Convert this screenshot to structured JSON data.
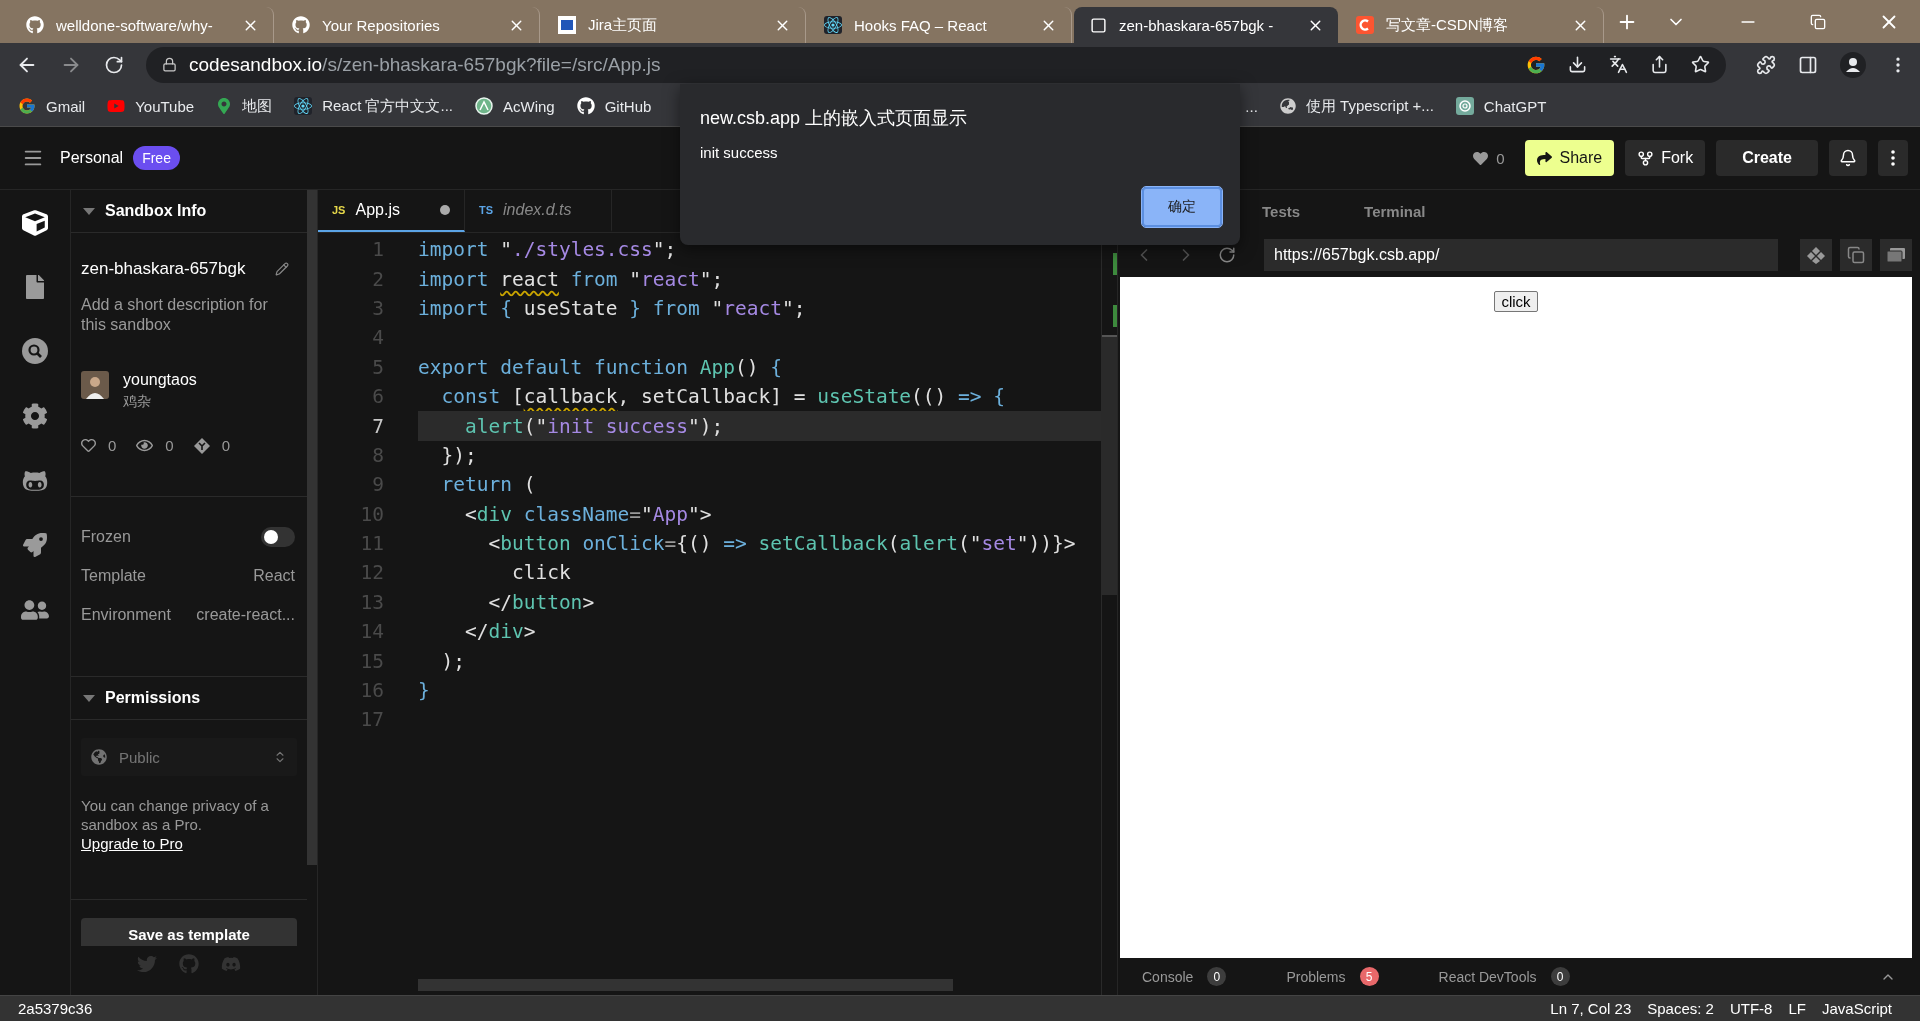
{
  "browser": {
    "tabs": [
      {
        "title": "welldone-software/why-",
        "selected": false
      },
      {
        "title": "Your Repositories",
        "selected": false
      },
      {
        "title": "Jira主页面",
        "selected": false
      },
      {
        "title": "Hooks FAQ – React",
        "selected": false
      },
      {
        "title": "zen-bhaskara-657bgk -",
        "selected": true
      },
      {
        "title": "写文章-CSDN博客",
        "selected": false
      }
    ],
    "address": {
      "host": "codesandbox.io",
      "path": "/s/zen-bhaskara-657bgk?file=/src/App.js"
    },
    "bookmarks": [
      {
        "label": "Gmail"
      },
      {
        "label": "YouTube"
      },
      {
        "label": "地图"
      },
      {
        "label": "React 官方中文文..."
      },
      {
        "label": "AcWing"
      },
      {
        "label": "GitHub"
      }
    ],
    "bookmarks_more": [
      {
        "label": "..."
      },
      {
        "label": "使用 Typescript +..."
      },
      {
        "label": "ChatGPT"
      }
    ]
  },
  "dialog": {
    "title": "new.csb.app 上的嵌入式页面显示",
    "message": "init success",
    "button": "确定"
  },
  "header": {
    "workspace": "Personal",
    "plan": "Free",
    "likes": "0",
    "buttons": [
      {
        "label": "Share",
        "kind": "primary"
      },
      {
        "label": "Fork",
        "kind": "fork"
      },
      {
        "label": "Create",
        "kind": "plain"
      }
    ]
  },
  "rail": [
    {
      "selected": true
    },
    {
      "selected": false
    },
    {
      "selected": false
    },
    {
      "selected": false
    },
    {
      "selected": false
    },
    {
      "selected": false
    },
    {
      "selected": false
    }
  ],
  "sandbox_info": {
    "heading": "Sandbox Info",
    "name": "zen-bhaskara-657bgk",
    "description": "Add a short description for this sandbox",
    "author": {
      "name": "youngtaos",
      "team": "鸡杂"
    },
    "stats": [
      {
        "kind": "likes",
        "value": "0"
      },
      {
        "kind": "views",
        "value": "0"
      },
      {
        "kind": "forks",
        "value": "0"
      }
    ],
    "settings": [
      {
        "kind": "toggle",
        "label": "Frozen",
        "on": false
      },
      {
        "kind": "value",
        "label": "Template",
        "value": "React"
      },
      {
        "kind": "value",
        "label": "Environment",
        "value": "create-react..."
      }
    ]
  },
  "permissions": {
    "heading": "Permissions",
    "privacy": {
      "value": "Public",
      "disabled": true
    },
    "note": "You can change privacy of a sandbox as a Pro.",
    "link": "Upgrade to Pro",
    "save_button": "Save as template"
  },
  "editor": {
    "tabs": [
      {
        "name": "App.js",
        "lang": "JS",
        "selected": true,
        "unsaved": true
      },
      {
        "name": "index.d.ts",
        "lang": "TS",
        "selected": false,
        "unsaved": false
      }
    ],
    "lines": [
      {
        "number": "1",
        "selected": false,
        "tokens": [
          {
            "text": "import ",
            "kind": "kw"
          },
          {
            "text": "\"",
            "kind": "p"
          },
          {
            "text": "./styles.css",
            "kind": "str"
          },
          {
            "text": "\";",
            "kind": "p"
          }
        ]
      },
      {
        "number": "2",
        "selected": false,
        "tokens": [
          {
            "text": "import ",
            "kind": "kw"
          },
          {
            "text": "react",
            "kind": "warn"
          },
          {
            "text": " from ",
            "kind": "kw"
          },
          {
            "text": "\"",
            "kind": "p"
          },
          {
            "text": "react",
            "kind": "str"
          },
          {
            "text": "\";",
            "kind": "p"
          }
        ]
      },
      {
        "number": "3",
        "selected": false,
        "tokens": [
          {
            "text": "import { ",
            "kind": "kw"
          },
          {
            "text": "useState ",
            "kind": "p"
          },
          {
            "text": "} from ",
            "kind": "kw"
          },
          {
            "text": "\"",
            "kind": "p"
          },
          {
            "text": "react",
            "kind": "str"
          },
          {
            "text": "\";",
            "kind": "p"
          }
        ]
      },
      {
        "number": "4",
        "selected": false
      },
      {
        "number": "5",
        "selected": false,
        "tokens": [
          {
            "text": "export default function ",
            "kind": "kw"
          },
          {
            "text": "App",
            "kind": "fn"
          },
          {
            "text": "() ",
            "kind": "p"
          },
          {
            "text": "{",
            "kind": "kw"
          }
        ]
      },
      {
        "number": "6",
        "selected": false,
        "tokens": [
          {
            "text": "  const ",
            "kind": "kw"
          },
          {
            "text": "[",
            "kind": "p"
          },
          {
            "text": "callback",
            "kind": "warn"
          },
          {
            "text": ", setCallback] = ",
            "kind": "p"
          },
          {
            "text": "useState",
            "kind": "fn"
          },
          {
            "text": "(() ",
            "kind": "p"
          },
          {
            "text": "=> {",
            "kind": "kw"
          }
        ]
      },
      {
        "number": "7",
        "selected": true,
        "tokens": [
          {
            "text": "    alert",
            "kind": "fn"
          },
          {
            "text": "(\"",
            "kind": "p"
          },
          {
            "text": "init success",
            "kind": "str"
          },
          {
            "text": "\");",
            "kind": "p"
          }
        ]
      },
      {
        "number": "8",
        "selected": false,
        "tokens": [
          {
            "text": "  });",
            "kind": "p"
          }
        ]
      },
      {
        "number": "9",
        "selected": false,
        "tokens": [
          {
            "text": "  return ",
            "kind": "kw"
          },
          {
            "text": "(",
            "kind": "p"
          }
        ]
      },
      {
        "number": "10",
        "selected": false,
        "tokens": [
          {
            "text": "    <",
            "kind": "p"
          },
          {
            "text": "div ",
            "kind": "fn"
          },
          {
            "text": "className",
            "kind": "kw"
          },
          {
            "text": "=",
            "kind": "dim"
          },
          {
            "text": "\"",
            "kind": "p"
          },
          {
            "text": "App",
            "kind": "str"
          },
          {
            "text": "\">",
            "kind": "p"
          }
        ]
      },
      {
        "number": "11",
        "selected": false,
        "tokens": [
          {
            "text": "      <",
            "kind": "p"
          },
          {
            "text": "button ",
            "kind": "fn"
          },
          {
            "text": "onClick",
            "kind": "kw"
          },
          {
            "text": "=",
            "kind": "dim"
          },
          {
            "text": "{() ",
            "kind": "p"
          },
          {
            "text": "=> ",
            "kind": "kw"
          },
          {
            "text": "setCallback",
            "kind": "fn"
          },
          {
            "text": "(",
            "kind": "p"
          },
          {
            "text": "alert",
            "kind": "fn"
          },
          {
            "text": "(\"",
            "kind": "p"
          },
          {
            "text": "set",
            "kind": "str"
          },
          {
            "text": "\"))}>",
            "kind": "p"
          }
        ]
      },
      {
        "number": "12",
        "selected": false,
        "tokens": [
          {
            "text": "        click",
            "kind": "p"
          }
        ]
      },
      {
        "number": "13",
        "selected": false,
        "tokens": [
          {
            "text": "      </",
            "kind": "p"
          },
          {
            "text": "button",
            "kind": "fn"
          },
          {
            "text": ">",
            "kind": "p"
          }
        ]
      },
      {
        "number": "14",
        "selected": false,
        "tokens": [
          {
            "text": "    </",
            "kind": "p"
          },
          {
            "text": "div",
            "kind": "fn"
          },
          {
            "text": ">",
            "kind": "p"
          }
        ]
      },
      {
        "number": "15",
        "selected": false,
        "tokens": [
          {
            "text": "  );",
            "kind": "p"
          }
        ]
      },
      {
        "number": "16",
        "selected": false,
        "tokens": [
          {
            "text": "}",
            "kind": "kw"
          }
        ]
      },
      {
        "number": "17",
        "selected": false
      }
    ]
  },
  "preview": {
    "tabs": [
      "Tests",
      "Terminal"
    ],
    "url": "https://657bgk.csb.app/",
    "page_button": "click",
    "panels": [
      {
        "label": "Console",
        "count": "0",
        "color": "#3d3d3d"
      },
      {
        "label": "Problems",
        "count": "5",
        "color": "#e8686a"
      },
      {
        "label": "React DevTools",
        "count": "0",
        "color": "#3d3d3d"
      }
    ]
  },
  "status_bar": {
    "commit": "2a5379c36",
    "items": [
      "Ln 7, Col 23",
      "Spaces: 2",
      "UTF-8",
      "LF",
      "JavaScript"
    ]
  }
}
